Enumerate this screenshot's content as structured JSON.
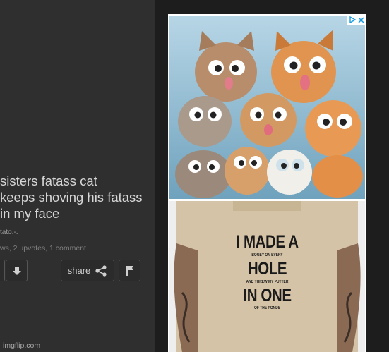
{
  "post": {
    "title": "sisters fatass cat\nkeeps shoving his fatass\nin my face",
    "author": "tato.-.",
    "stats": "ws, 2 upvotes, 1 comment",
    "share_label": "share"
  },
  "footer": {
    "brand": "imgflip.com"
  },
  "ad": {
    "shirt_lines": [
      "I MADE A",
      "BOGEY ON EVERY",
      "HOLE",
      "AND THREW MY PUTTER",
      "IN ONE",
      "OF THE PONDS"
    ]
  },
  "icons": [
    "upvote-icon",
    "downvote-icon",
    "share-icon",
    "flag-icon",
    "adchoices-icon",
    "close-icon"
  ],
  "colors": {
    "panel": "#2f2f2f",
    "background": "#1d1d1d",
    "text": "#d6d6d6",
    "adchoices": "#1a9de0"
  }
}
